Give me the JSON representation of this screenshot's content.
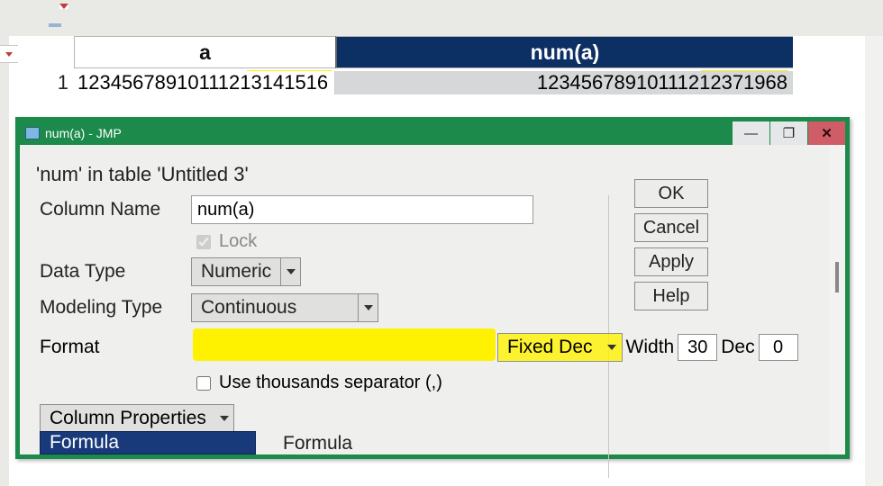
{
  "sheet": {
    "header_a": "a",
    "header_num": "num(a)",
    "row_num": "1",
    "cell_a": "1234567891011121",
    "cell_a_hl": "3141516",
    "cell_num_prefix": "1234567891011121",
    "cell_num_hl": "2371968"
  },
  "dialog": {
    "window_title": "num(a) - JMP",
    "crumb": "'num' in table 'Untitled 3'",
    "labels": {
      "column_name": "Column Name",
      "lock": "Lock",
      "data_type": "Data Type",
      "modeling_type": "Modeling Type",
      "format": "Format",
      "width": "Width",
      "dec": "Dec",
      "thousands": "Use thousands separator (,)",
      "column_properties": "Column Properties",
      "formula": "Formula",
      "formula2": "Formula"
    },
    "values": {
      "column_name": "num(a)",
      "data_type": "Numeric",
      "modeling_type": "Continuous",
      "format_type": "Fixed Dec",
      "width": "30",
      "dec": "0"
    },
    "buttons": {
      "ok": "OK",
      "cancel": "Cancel",
      "apply": "Apply",
      "help": "Help"
    },
    "winctl": {
      "min": "—",
      "max": "❐",
      "close": "✕"
    }
  }
}
